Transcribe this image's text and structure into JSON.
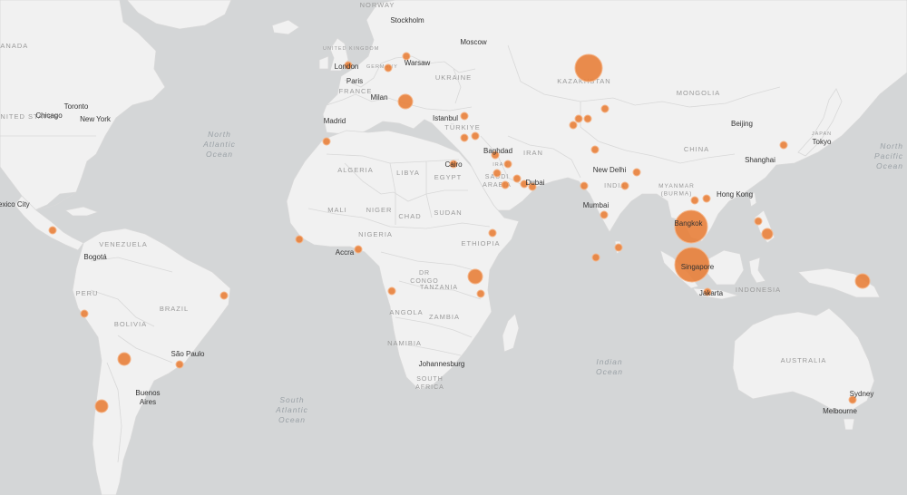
{
  "colors": {
    "ocean": "#d4d6d7",
    "land": "#f1f1f1",
    "border": "#d8d8d8",
    "marker": "#e8803a",
    "marker_stroke": "#f4b488",
    "city_text": "#333333",
    "country_text": "#9a9a9a",
    "ocean_text": "#9aa1a6"
  },
  "countries": [
    {
      "id": "canada",
      "label": "CANADA"
    },
    {
      "id": "usa",
      "label": "UNITED STATES"
    },
    {
      "id": "norway",
      "label": "NORWAY"
    },
    {
      "id": "uk",
      "label": "UNITED KINGDOM"
    },
    {
      "id": "germany",
      "label": "GERMANY"
    },
    {
      "id": "france",
      "label": "FRANCE"
    },
    {
      "id": "ukraine",
      "label": "UKRAINE"
    },
    {
      "id": "turkiye",
      "label": "TÜRKIYE"
    },
    {
      "id": "kazakhstan",
      "label": "KAZAKHSTAN"
    },
    {
      "id": "mongolia",
      "label": "MONGOLIA"
    },
    {
      "id": "china",
      "label": "CHINA"
    },
    {
      "id": "japan",
      "label": "JAPAN"
    },
    {
      "id": "iran",
      "label": "IRAN"
    },
    {
      "id": "iraq",
      "label": "IRAQ"
    },
    {
      "id": "saudi",
      "label": "SAUDI ARABIA"
    },
    {
      "id": "egypt",
      "label": "EGYPT"
    },
    {
      "id": "libya",
      "label": "LIBYA"
    },
    {
      "id": "algeria",
      "label": "ALGERIA"
    },
    {
      "id": "mali",
      "label": "MALI"
    },
    {
      "id": "niger",
      "label": "NIGER"
    },
    {
      "id": "chad",
      "label": "CHAD"
    },
    {
      "id": "sudan",
      "label": "SUDAN"
    },
    {
      "id": "nigeria",
      "label": "NIGERIA"
    },
    {
      "id": "ethiopia",
      "label": "ETHIOPIA"
    },
    {
      "id": "drc",
      "label": "DR CONGO"
    },
    {
      "id": "tanzania",
      "label": "TANZANIA"
    },
    {
      "id": "angola",
      "label": "ANGOLA"
    },
    {
      "id": "zambia",
      "label": "ZAMBIA"
    },
    {
      "id": "namibia",
      "label": "NAMIBIA"
    },
    {
      "id": "southafrica",
      "label": "SOUTH AFRICA"
    },
    {
      "id": "india",
      "label": "INDIA"
    },
    {
      "id": "myanmar",
      "label": "MYANMAR (BURMA)"
    },
    {
      "id": "indonesia",
      "label": "INDONESIA"
    },
    {
      "id": "australia",
      "label": "AUSTRALIA"
    },
    {
      "id": "venezuela",
      "label": "VENEZUELA"
    },
    {
      "id": "peru",
      "label": "PERU"
    },
    {
      "id": "brazil",
      "label": "BRAZIL"
    },
    {
      "id": "bolivia",
      "label": "BOLIVIA"
    }
  ],
  "oceans": [
    {
      "id": "north-atlantic",
      "label": "North Atlantic Ocean"
    },
    {
      "id": "south-atlantic",
      "label": "South Atlantic Ocean"
    },
    {
      "id": "indian",
      "label": "Indian Ocean"
    },
    {
      "id": "north-pacific",
      "label": "North Pacific Ocean"
    }
  ],
  "cities": [
    {
      "id": "stockholm",
      "label": "Stockholm"
    },
    {
      "id": "moscow",
      "label": "Moscow"
    },
    {
      "id": "london",
      "label": "London"
    },
    {
      "id": "warsaw",
      "label": "Warsaw"
    },
    {
      "id": "paris",
      "label": "Paris"
    },
    {
      "id": "milan",
      "label": "Milan"
    },
    {
      "id": "madrid",
      "label": "Madrid"
    },
    {
      "id": "istanbul",
      "label": "Istanbul"
    },
    {
      "id": "baghdad",
      "label": "Baghdad"
    },
    {
      "id": "cairo",
      "label": "Cairo"
    },
    {
      "id": "dubai",
      "label": "Dubai"
    },
    {
      "id": "newdelhi",
      "label": "New Delhi"
    },
    {
      "id": "mumbai",
      "label": "Mumbai"
    },
    {
      "id": "beijing",
      "label": "Beijing"
    },
    {
      "id": "tokyo",
      "label": "Tokyo"
    },
    {
      "id": "shanghai",
      "label": "Shanghai"
    },
    {
      "id": "hongkong",
      "label": "Hong Kong"
    },
    {
      "id": "bangkok",
      "label": "Bangkok"
    },
    {
      "id": "singapore",
      "label": "Singapore"
    },
    {
      "id": "jakarta",
      "label": "Jakarta"
    },
    {
      "id": "sydney",
      "label": "Sydney"
    },
    {
      "id": "melbourne",
      "label": "Melbourne"
    },
    {
      "id": "toronto",
      "label": "Toronto"
    },
    {
      "id": "chicago",
      "label": "Chicago"
    },
    {
      "id": "newyork",
      "label": "New York"
    },
    {
      "id": "mexicocity",
      "label": "Mexico City"
    },
    {
      "id": "bogota",
      "label": "Bogotá"
    },
    {
      "id": "saopaulo",
      "label": "São Paulo"
    },
    {
      "id": "buenosaires",
      "label": "Buenos Aires"
    },
    {
      "id": "accra",
      "label": "Accra"
    },
    {
      "id": "johannesburg",
      "label": "Johannesburg"
    }
  ]
}
